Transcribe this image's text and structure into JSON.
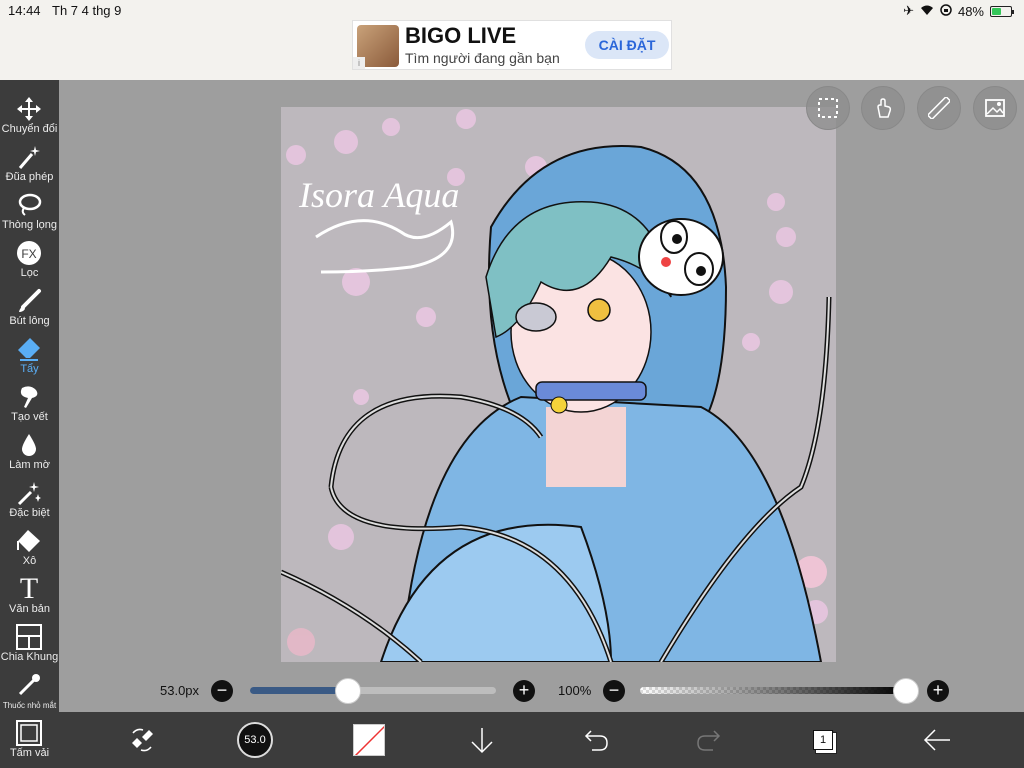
{
  "status_bar": {
    "time": "14:44",
    "date": "Th 7 4 thg 9",
    "battery": "48%",
    "battery_level": 0.48
  },
  "ad": {
    "title": "BIGO LIVE",
    "subtitle": "Tìm người đang gần bạn",
    "button": "CÀI ĐẶT"
  },
  "tools": [
    {
      "label": "Chuyển đổi",
      "icon": "move-icon"
    },
    {
      "label": "Đũa phép",
      "icon": "magic-wand-icon"
    },
    {
      "label": "Thòng lọng",
      "icon": "lasso-icon"
    },
    {
      "label": "Lọc",
      "icon": "fx-filter-icon"
    },
    {
      "label": "Bút lông",
      "icon": "brush-icon"
    },
    {
      "label": "Tẩy",
      "icon": "eraser-icon",
      "active": true
    },
    {
      "label": "Tạo vết",
      "icon": "smudge-icon"
    },
    {
      "label": "Làm mờ",
      "icon": "blur-drop-icon"
    },
    {
      "label": "Đặc biệt",
      "icon": "special-sparkle-icon"
    },
    {
      "label": "Xô",
      "icon": "bucket-icon"
    },
    {
      "label": "Văn bản",
      "icon": "text-icon"
    },
    {
      "label": "Chia Khung",
      "icon": "frame-divider-icon"
    },
    {
      "label": "Thuốc nhỏ mắt",
      "icon": "eyedropper-icon"
    },
    {
      "label": "Tấm vải",
      "icon": "canvas-icon"
    }
  ],
  "canvas": {
    "signature": "Isora Aqua"
  },
  "brush_size": {
    "label": "53.0px",
    "value": 53.0,
    "fraction": 0.4
  },
  "opacity": {
    "label": "100%",
    "fraction": 1.0
  },
  "bottom_toolbar": {
    "brush_indicator": "53.0",
    "layer_count": "1"
  },
  "colors": {
    "toolbar_bg": "#3c3c3c",
    "active_tool": "#5aaef5",
    "canvas_bg": "#9e9e9e",
    "size_fill": "#3a5a85"
  }
}
